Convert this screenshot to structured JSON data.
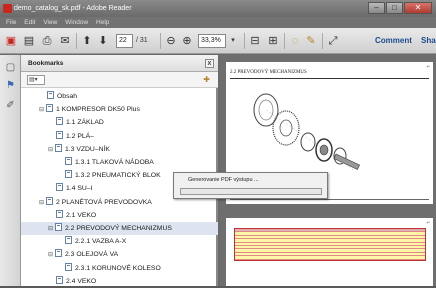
{
  "window": {
    "title": "demo_catalog_sk.pdf - Adobe Reader",
    "minimize": "–",
    "maximize": "□",
    "close": "✕"
  },
  "menu": [
    "File",
    "Edit",
    "View",
    "Window",
    "Help"
  ],
  "toolbar": {
    "page_current": "22",
    "page_total": "/ 31",
    "zoom": "33,3%",
    "comment_label": "Comment",
    "share_label": "Sha"
  },
  "panel": {
    "title": "Bookmarks",
    "close": "x"
  },
  "bookmarks": [
    {
      "label": "Obsah",
      "level": 0,
      "expander": ""
    },
    {
      "label": "1 KOMPRESOR DK50 Plus",
      "level": 0,
      "expander": "⊟"
    },
    {
      "label": "1.1 ZÁKLAD",
      "level": 1,
      "expander": ""
    },
    {
      "label": "1.2 PLÁ–",
      "level": 1,
      "expander": ""
    },
    {
      "label": "1.3 VZDU–NÍK",
      "level": 1,
      "expander": "⊟"
    },
    {
      "label": "1.3.1 TLAKOVÁ NÁDOBA",
      "level": 2,
      "expander": ""
    },
    {
      "label": "1.3.2 PNEUMATICKÝ BLOK",
      "level": 2,
      "expander": ""
    },
    {
      "label": "1.4 SU–I",
      "level": 1,
      "expander": ""
    },
    {
      "label": "2 PLANÉTOVÁ PREVODOVKA",
      "level": 0,
      "expander": "⊟"
    },
    {
      "label": "2.1 VEKO",
      "level": 1,
      "expander": ""
    },
    {
      "label": "2.2 PREVODOVÝ MECHANIZMUS",
      "level": 1,
      "expander": "⊟",
      "selected": true
    },
    {
      "label": "2.2.1 VAZBA A-X",
      "level": 2,
      "expander": ""
    },
    {
      "label": "2.3 OLEJOVÁ VA",
      "level": 1,
      "expander": "⊟"
    },
    {
      "label": "2.3.1 KORUNOVÉ KOLESO",
      "level": 2,
      "expander": ""
    },
    {
      "label": "2.4 VEKO",
      "level": 1,
      "expander": ""
    }
  ],
  "document": {
    "page1_heading": "2.2 PREVODOVÝ MECHANIZMUS"
  },
  "dialog": {
    "message": "Generovanie PDF výstupu ..."
  },
  "colors": {
    "accent_link": "#1d4d8c",
    "title_bar": "#6a6a6a",
    "table_fill": "#fff6a8",
    "table_border": "#b33"
  }
}
